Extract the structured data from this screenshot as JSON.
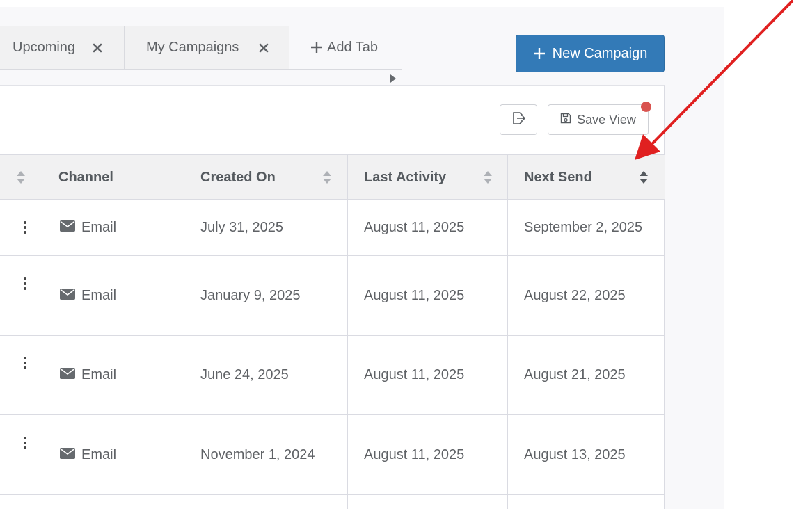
{
  "tabs": [
    {
      "label": "Upcoming",
      "closable": true
    },
    {
      "label": "My Campaigns",
      "closable": true
    }
  ],
  "add_tab_label": "Add Tab",
  "new_campaign_label": "New Campaign",
  "toolbar": {
    "save_view_label": "Save View"
  },
  "colors": {
    "accent": "#337ab7",
    "notification": "#d9534f",
    "annotation_arrow": "#e02020"
  },
  "table": {
    "columns": [
      "",
      "Channel",
      "Created On",
      "Last Activity",
      "Next Send"
    ],
    "rows": [
      {
        "channel": "Email",
        "created_on": "July 31, 2025",
        "last_activity": "August 11, 2025",
        "next_send": "September 2, 2025"
      },
      {
        "channel": "Email",
        "created_on": "January 9, 2025",
        "last_activity": "August 11, 2025",
        "next_send": "August 22, 2025"
      },
      {
        "channel": "Email",
        "created_on": "June 24, 2025",
        "last_activity": "August 11, 2025",
        "next_send": "August 21, 2025"
      },
      {
        "channel": "Email",
        "created_on": "November 1, 2024",
        "last_activity": "August 11, 2025",
        "next_send": "August 13, 2025"
      }
    ]
  },
  "icons": {
    "close": "close-icon",
    "plus": "plus-icon",
    "export": "export-icon",
    "save": "floppy-disk-icon",
    "sort": "sort-icon",
    "kebab": "kebab-menu-icon",
    "envelope": "envelope-icon",
    "scroll": "triangle-right-icon"
  }
}
